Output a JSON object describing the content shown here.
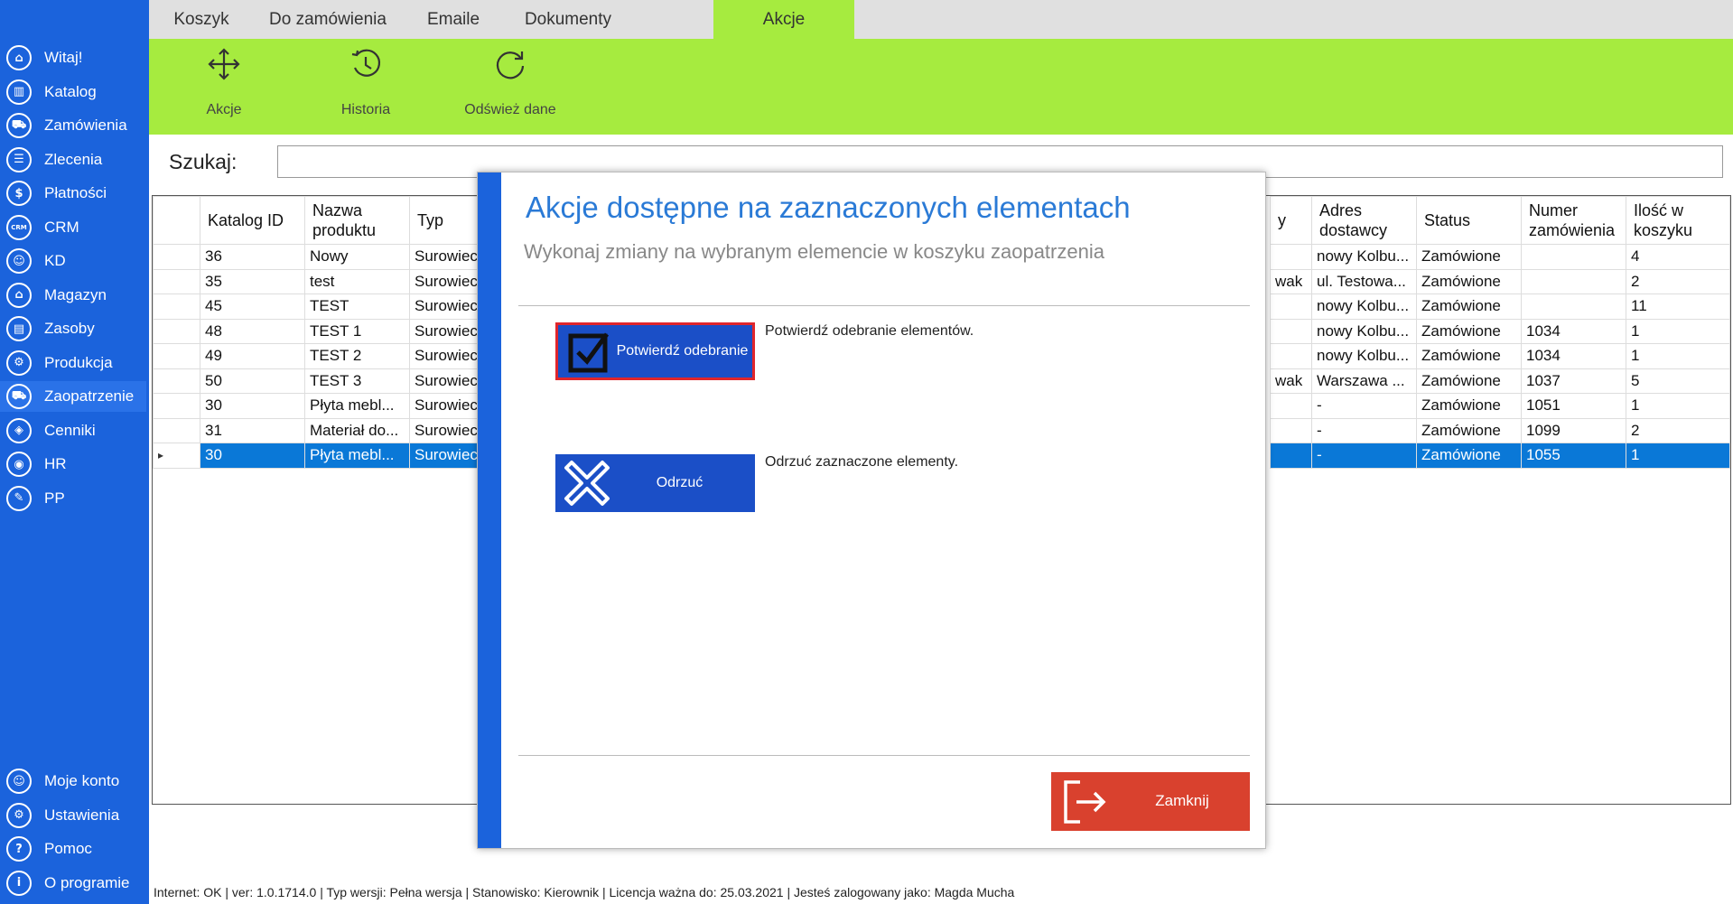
{
  "sidebar": {
    "items": [
      {
        "label": "Witaj!",
        "icon": "home-icon",
        "glyph": "⌂"
      },
      {
        "label": "Katalog",
        "icon": "book-icon",
        "glyph": "▥"
      },
      {
        "label": "Zamówienia",
        "icon": "cart-icon",
        "glyph": "⛟"
      },
      {
        "label": "Zlecenia",
        "icon": "list-icon",
        "glyph": "☰"
      },
      {
        "label": "Płatności",
        "icon": "dollar-icon",
        "glyph": "$"
      },
      {
        "label": "CRM",
        "icon": "crm-icon",
        "glyph": "CRM"
      },
      {
        "label": "KD",
        "icon": "person-icon",
        "glyph": "☺"
      },
      {
        "label": "Magazyn",
        "icon": "warehouse-icon",
        "glyph": "⌂"
      },
      {
        "label": "Zasoby",
        "icon": "resources-icon",
        "glyph": "▤"
      },
      {
        "label": "Produkcja",
        "icon": "production-icon",
        "glyph": "⚙"
      },
      {
        "label": "Zaopatrzenie",
        "icon": "truck-icon",
        "glyph": "⛟"
      },
      {
        "label": "Cenniki",
        "icon": "tag-icon",
        "glyph": "◈"
      },
      {
        "label": "HR",
        "icon": "hr-icon",
        "glyph": "◉"
      },
      {
        "label": "PP",
        "icon": "pp-icon",
        "glyph": "✎"
      }
    ],
    "bottom_items": [
      {
        "label": "Moje konto",
        "icon": "account-icon",
        "glyph": "☺"
      },
      {
        "label": "Ustawienia",
        "icon": "settings-icon",
        "glyph": "⚙"
      },
      {
        "label": "Pomoc",
        "icon": "help-icon",
        "glyph": "?"
      },
      {
        "label": "O programie",
        "icon": "info-icon",
        "glyph": "i"
      }
    ],
    "active": "Zaopatrzenie"
  },
  "tabs": [
    "Koszyk",
    "Do zamówienia",
    "Emaile",
    "Dokumenty",
    "Akcje"
  ],
  "active_tab": "Akcje",
  "ribbon": {
    "akcje": "Akcje",
    "historia": "Historia",
    "odswiez": "Odśwież dane"
  },
  "search": {
    "label": "Szukaj:",
    "value": ""
  },
  "grid": {
    "left_headers": [
      "Katalog ID",
      "Nazwa produktu",
      "Typ"
    ],
    "right_headers": [
      "Adres dostawcy",
      "Status",
      "Numer zamówienia",
      "Ilość w koszyku"
    ],
    "right_partial_header": "y",
    "rows": [
      {
        "id": "36",
        "name": "Nowy",
        "type": "Surowiec",
        "partial": "",
        "addr": "nowy Kolbu...",
        "status": "Zamówione",
        "order": "",
        "qty": "4"
      },
      {
        "id": "35",
        "name": "test",
        "type": "Surowiec",
        "partial": "wak",
        "addr": "ul. Testowa...",
        "status": "Zamówione",
        "order": "",
        "qty": "2"
      },
      {
        "id": "45",
        "name": "TEST",
        "type": "Surowiec",
        "partial": "",
        "addr": "nowy Kolbu...",
        "status": "Zamówione",
        "order": "",
        "qty": "11"
      },
      {
        "id": "48",
        "name": "TEST 1",
        "type": "Surowiec",
        "partial": "",
        "addr": "nowy Kolbu...",
        "status": "Zamówione",
        "order": "1034",
        "qty": "1"
      },
      {
        "id": "49",
        "name": "TEST 2",
        "type": "Surowiec",
        "partial": "",
        "addr": "nowy Kolbu...",
        "status": "Zamówione",
        "order": "1034",
        "qty": "1"
      },
      {
        "id": "50",
        "name": "TEST 3",
        "type": "Surowiec",
        "partial": "wak",
        "addr": "Warszawa ...",
        "status": "Zamówione",
        "order": "1037",
        "qty": "5"
      },
      {
        "id": "30",
        "name": "Płyta mebl...",
        "type": "Surowiec",
        "partial": "",
        "addr": "-",
        "status": "Zamówione",
        "order": "1051",
        "qty": "1"
      },
      {
        "id": "31",
        "name": "Materiał do...",
        "type": "Surowiec",
        "partial": "",
        "addr": "-",
        "status": "Zamówione",
        "order": "1099",
        "qty": "2"
      },
      {
        "id": "30",
        "name": "Płyta mebl...",
        "type": "Surowiec",
        "partial": "",
        "addr": "-",
        "status": "Zamówione",
        "order": "1055",
        "qty": "1"
      }
    ],
    "selected_row": 8
  },
  "modal": {
    "title": "Akcje dostępne na zaznaczonych elementach",
    "subtitle": "Wykonaj zmiany na wybranym elemencie w koszyku zaopatrzenia",
    "confirm_label": "Potwierdź odebranie",
    "confirm_desc": "Potwierdź odebranie elementów.",
    "reject_label": "Odrzuć",
    "reject_desc": "Odrzuć zaznaczone elementy.",
    "close_label": "Zamknij"
  },
  "statusbar": "Internet: OK  |  ver: 1.0.1714.0  |  Typ wersji: Pełna wersja  |  Stanowisko: Kierownik  |  Licencja ważna do: 25.03.2021  |  Jesteś zalogowany jako: Magda Mucha",
  "colors": {
    "sidebar": "#1b63dc",
    "ribbon": "#a6eb3f",
    "selected_row": "#0a78d7",
    "close_button": "#d9412e",
    "modal_title": "#2a7ad6"
  }
}
